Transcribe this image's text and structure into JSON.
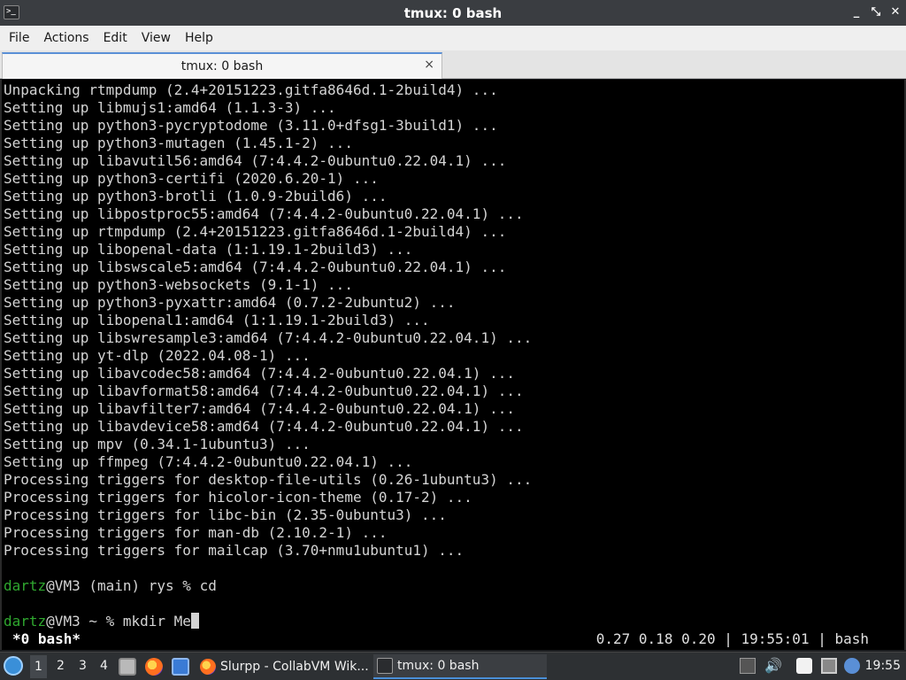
{
  "window": {
    "title": "tmux: 0 bash",
    "minimize_glyph": "_",
    "maximize_glyph": "⤡",
    "close_glyph": "✕"
  },
  "menu": [
    "File",
    "Actions",
    "Edit",
    "View",
    "Help"
  ],
  "tab": {
    "label": "tmux: 0 bash",
    "close_glyph": "×"
  },
  "terminal": {
    "lines": [
      "Unpacking rtmpdump (2.4+20151223.gitfa8646d.1-2build4) ...",
      "Setting up libmujs1:amd64 (1.1.3-3) ...",
      "Setting up python3-pycryptodome (3.11.0+dfsg1-3build1) ...",
      "Setting up python3-mutagen (1.45.1-2) ...",
      "Setting up libavutil56:amd64 (7:4.4.2-0ubuntu0.22.04.1) ...",
      "Setting up python3-certifi (2020.6.20-1) ...",
      "Setting up python3-brotli (1.0.9-2build6) ...",
      "Setting up libpostproc55:amd64 (7:4.4.2-0ubuntu0.22.04.1) ...",
      "Setting up rtmpdump (2.4+20151223.gitfa8646d.1-2build4) ...",
      "Setting up libopenal-data (1:1.19.1-2build3) ...",
      "Setting up libswscale5:amd64 (7:4.4.2-0ubuntu0.22.04.1) ...",
      "Setting up python3-websockets (9.1-1) ...",
      "Setting up python3-pyxattr:amd64 (0.7.2-2ubuntu2) ...",
      "Setting up libopenal1:amd64 (1:1.19.1-2build3) ...",
      "Setting up libswresample3:amd64 (7:4.4.2-0ubuntu0.22.04.1) ...",
      "Setting up yt-dlp (2022.04.08-1) ...",
      "Setting up libavcodec58:amd64 (7:4.4.2-0ubuntu0.22.04.1) ...",
      "Setting up libavformat58:amd64 (7:4.4.2-0ubuntu0.22.04.1) ...",
      "Setting up libavfilter7:amd64 (7:4.4.2-0ubuntu0.22.04.1) ...",
      "Setting up libavdevice58:amd64 (7:4.4.2-0ubuntu0.22.04.1) ...",
      "Setting up mpv (0.34.1-1ubuntu3) ...",
      "Setting up ffmpeg (7:4.4.2-0ubuntu0.22.04.1) ...",
      "Processing triggers for desktop-file-utils (0.26-1ubuntu3) ...",
      "Processing triggers for hicolor-icon-theme (0.17-2) ...",
      "Processing triggers for libc-bin (2.35-0ubuntu3) ...",
      "Processing triggers for man-db (2.10.2-1) ...",
      "Processing triggers for mailcap (3.70+nmu1ubuntu1) ..."
    ],
    "prompt1": {
      "user": "dartz",
      "rest": "@VM3 (main) rys % cd"
    },
    "prompt2": {
      "user": "dartz",
      "rest": "@VM3 ~ % mkdir Me"
    },
    "user_color": "#2fa82f"
  },
  "tmux": {
    "window_label": "*0 bash*",
    "right_status": "0.27 0.18 0.20 | 19:55:01 | bash"
  },
  "taskbar": {
    "workspaces": [
      "1",
      "2",
      "3",
      "4"
    ],
    "tasks": [
      {
        "label": "Slurpp - CollabVM Wik..."
      },
      {
        "label": "tmux: 0 bash"
      }
    ],
    "clock": "19:55"
  }
}
